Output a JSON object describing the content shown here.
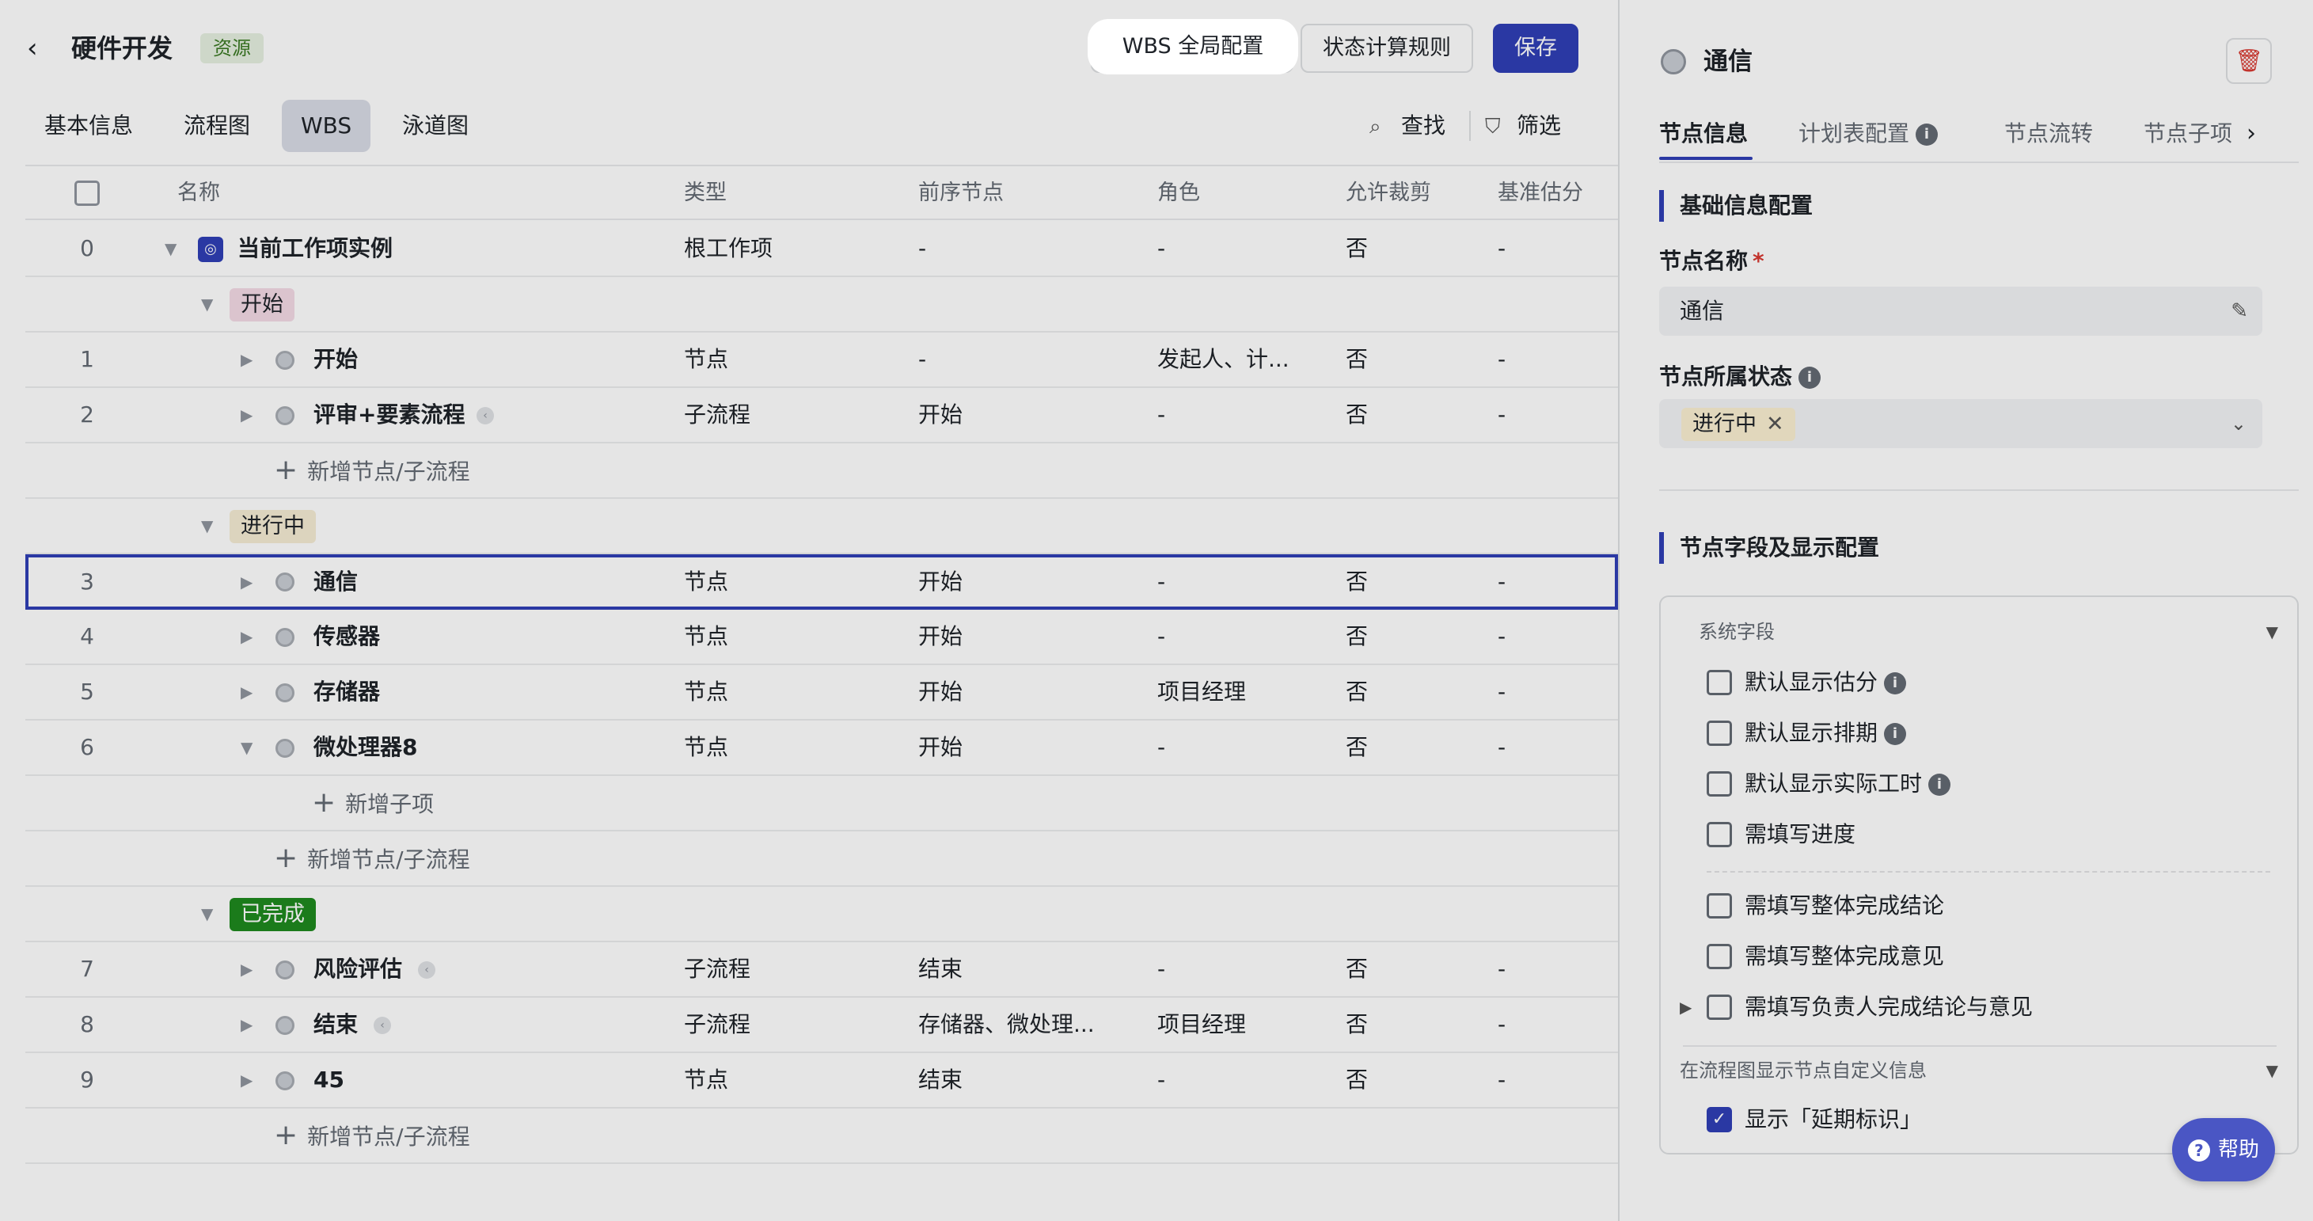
{
  "header": {
    "back_icon": "chevron-left-icon",
    "title": "硬件开发",
    "badge": "资源",
    "btn_wbs": "WBS 全局配置",
    "btn_rule": "状态计算规则",
    "btn_save": "保存"
  },
  "tabs": [
    {
      "label": "基本信息"
    },
    {
      "label": "流程图"
    },
    {
      "label": "WBS"
    },
    {
      "label": "泳道图"
    }
  ],
  "toolbar": {
    "find": "查找",
    "filter": "筛选"
  },
  "columns": [
    "名称",
    "类型",
    "前序节点",
    "角色",
    "允许裁剪",
    "基准估分"
  ],
  "root_row": {
    "index": "0",
    "name": "当前工作项实例",
    "type": "根工作项",
    "prev": "-",
    "role": "-",
    "cut": "否",
    "est": "-"
  },
  "groups": [
    {
      "label": "开始",
      "color": "#f4dbe6",
      "rows": [
        {
          "index": "1",
          "name": "开始",
          "type": "节点",
          "prev": "-",
          "role": "发起人、计...",
          "cut": "否",
          "est": "-",
          "sub": false
        },
        {
          "index": "2",
          "name": "评审+要素流程",
          "type": "子流程",
          "prev": "开始",
          "role": "-",
          "cut": "否",
          "est": "-",
          "sub": true
        }
      ],
      "add": "新增节点/子流程"
    },
    {
      "label": "进行中",
      "color": "#f5ecd4",
      "rows": [
        {
          "index": "3",
          "name": "通信",
          "type": "节点",
          "prev": "开始",
          "role": "-",
          "cut": "否",
          "est": "-",
          "sub": false
        },
        {
          "index": "4",
          "name": "传感器",
          "type": "节点",
          "prev": "开始",
          "role": "-",
          "cut": "否",
          "est": "-",
          "sub": false
        },
        {
          "index": "5",
          "name": "存储器",
          "type": "节点",
          "prev": "开始",
          "role": "项目经理",
          "cut": "否",
          "est": "-",
          "sub": false
        },
        {
          "index": "6",
          "name": "微处理器8",
          "type": "节点",
          "prev": "开始",
          "role": "-",
          "cut": "否",
          "est": "-",
          "sub": false
        }
      ],
      "add_child": "新增子项",
      "add": "新增节点/子流程"
    },
    {
      "label": "已完成",
      "color": "#1f8a1f",
      "rows": [
        {
          "index": "7",
          "name": "风险评估",
          "type": "子流程",
          "prev": "结束",
          "role": "-",
          "cut": "否",
          "est": "-",
          "sub": true
        },
        {
          "index": "8",
          "name": "结束",
          "type": "子流程",
          "prev": "存储器、微处理...",
          "role": "项目经理",
          "cut": "否",
          "est": "-",
          "sub": true
        },
        {
          "index": "9",
          "name": "45",
          "type": "节点",
          "prev": "结束",
          "role": "-",
          "cut": "否",
          "est": "-",
          "sub": false
        }
      ],
      "add": "新增节点/子流程"
    }
  ],
  "panel": {
    "title": "通信",
    "tabs": [
      "节点信息",
      "计划表配置",
      "节点流转",
      "节点子项"
    ],
    "section1": "基础信息配置",
    "name_label": "节点名称",
    "required_mark": "*",
    "name_value": "通信",
    "status_label": "节点所属状态",
    "status_value": "进行中",
    "section2": "节点字段及显示配置",
    "system_fields": "系统字段",
    "checks": [
      {
        "label": "默认显示估分",
        "info": true,
        "checked": false
      },
      {
        "label": "默认显示排期",
        "info": true,
        "checked": false
      },
      {
        "label": "默认显示实际工时",
        "info": true,
        "checked": false
      },
      {
        "label": "需填写进度",
        "info": false,
        "checked": false
      },
      {
        "label": "需填写整体完成结论",
        "info": false,
        "checked": false
      },
      {
        "label": "需填写整体完成意见",
        "info": false,
        "checked": false
      },
      {
        "label": "需填写负责人完成结论与意见",
        "info": false,
        "checked": false
      }
    ],
    "flow_info": "在流程图显示节点自定义信息",
    "delay_check": "显示「延期标识」"
  },
  "help": "帮助"
}
